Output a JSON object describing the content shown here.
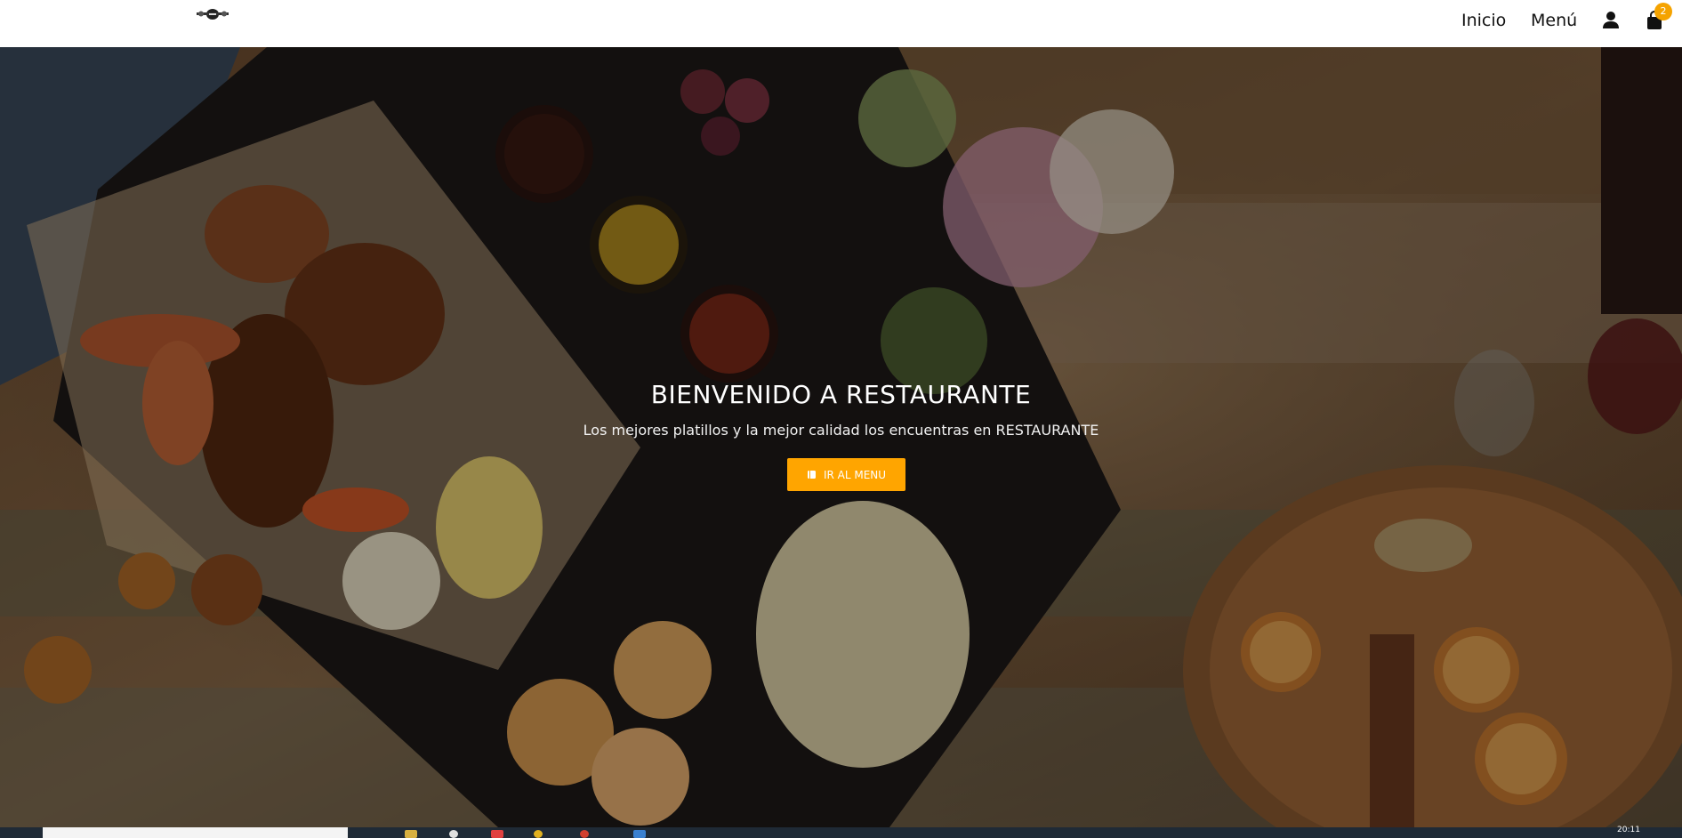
{
  "navbar": {
    "links": {
      "inicio": "Inicio",
      "menu": "Menú"
    },
    "cart_count": "2",
    "icons": [
      "logo-icon",
      "user-icon",
      "shopping-bag-icon"
    ]
  },
  "hero": {
    "title": "BIENVENIDO A RESTAURANTE",
    "subtitle": "Los mejores platillos y la mejor calidad los encuentras en RESTAURANTE",
    "button_label": "IR AL MENU",
    "button_icon": "book-icon"
  },
  "taskbar": {
    "clock": "20:11"
  },
  "colors": {
    "accent": "#ffa500",
    "navbar_bg": "#ffffff",
    "badge": "#f5a300",
    "taskbar": "#1f2a36"
  }
}
